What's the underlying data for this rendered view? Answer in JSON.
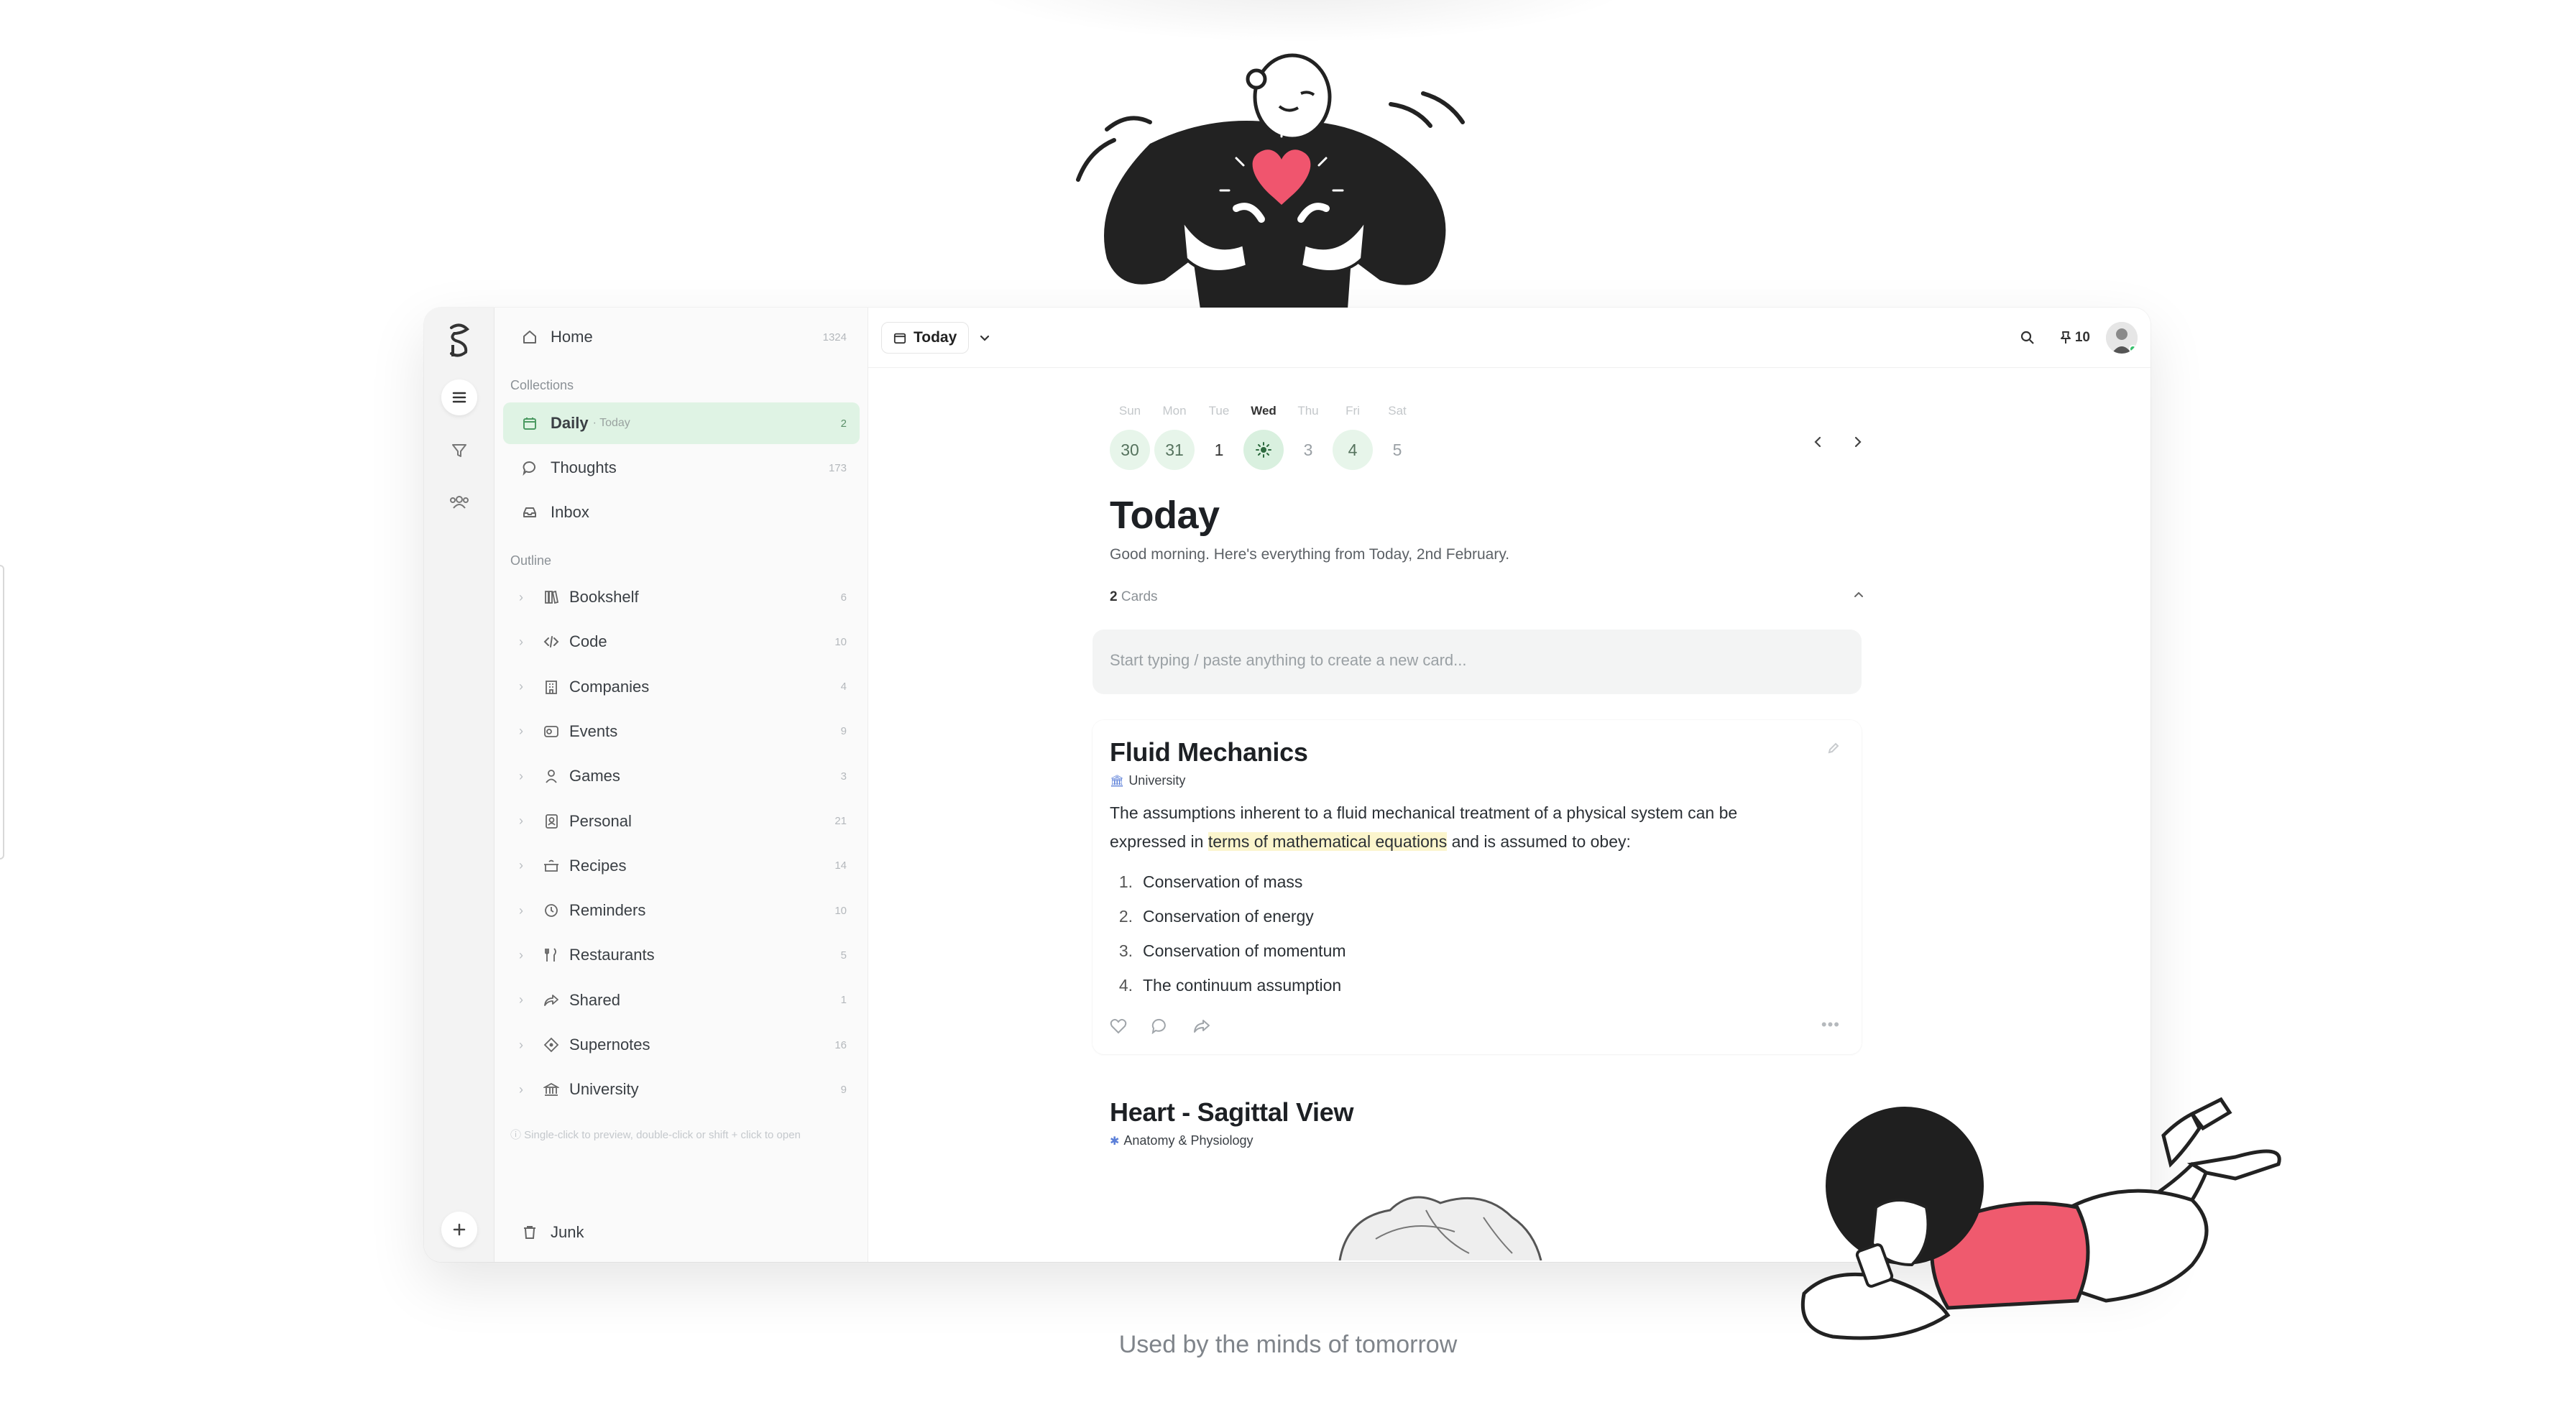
{
  "sidebar": {
    "home": {
      "label": "Home",
      "count": "1324"
    },
    "collections_label": "Collections",
    "collections": [
      {
        "label": "Daily",
        "sub": "· Today",
        "count": "2",
        "icon": "calendar-icon",
        "selected": true
      },
      {
        "label": "Thoughts",
        "count": "173",
        "icon": "speech-bubble-icon"
      },
      {
        "label": "Inbox",
        "count": "",
        "icon": "inbox-tray-icon"
      }
    ],
    "outline_label": "Outline",
    "outline": [
      {
        "label": "Bookshelf",
        "count": "6",
        "icon": "books-icon"
      },
      {
        "label": "Code",
        "count": "10",
        "icon": "code-icon"
      },
      {
        "label": "Companies",
        "count": "4",
        "icon": "building-icon"
      },
      {
        "label": "Events",
        "count": "9",
        "icon": "events-icon"
      },
      {
        "label": "Games",
        "count": "3",
        "icon": "person-icon"
      },
      {
        "label": "Personal",
        "count": "21",
        "icon": "contact-book-icon"
      },
      {
        "label": "Recipes",
        "count": "14",
        "icon": "cooking-pot-icon"
      },
      {
        "label": "Reminders",
        "count": "10",
        "icon": "clock-icon"
      },
      {
        "label": "Restaurants",
        "count": "5",
        "icon": "cutlery-icon"
      },
      {
        "label": "Shared",
        "count": "1",
        "icon": "share-icon"
      },
      {
        "label": "Supernotes",
        "count": "16",
        "icon": "diamond-icon"
      },
      {
        "label": "University",
        "count": "9",
        "icon": "university-icon"
      }
    ],
    "hint": "ⓘ Single-click to preview, double-click or shift + click to open",
    "junk": "Junk"
  },
  "topbar": {
    "today_label": "Today",
    "pin_count": "10"
  },
  "week": {
    "days": [
      "Sun",
      "Mon",
      "Tue",
      "Wed",
      "Thu",
      "Fri",
      "Sat"
    ],
    "dates": [
      "30",
      "31",
      "1",
      "",
      "3",
      "4",
      "5"
    ],
    "current_day_index": 3
  },
  "page": {
    "title": "Today",
    "subtitle": "Good morning. Here's everything from Today, 2nd February.",
    "cards_count": "2",
    "cards_label": "Cards",
    "new_card_placeholder": "Start typing / paste anything to create a new card..."
  },
  "cards": [
    {
      "title": "Fluid Mechanics",
      "tag": "University",
      "body_before": "The assumptions inherent to a fluid mechanical treatment of a physical system can be expressed in ",
      "body_highlight": "terms of mathematical equations",
      "body_after": " and is assumed to obey:",
      "list": [
        "Conservation of mass",
        "Conservation of energy",
        "Conservation of momentum",
        "The continuum assumption"
      ]
    },
    {
      "title": "Heart - Sagittal View",
      "tag": "Anatomy & Physiology"
    }
  ],
  "tagline": "Used by the minds of tomorrow",
  "colors": {
    "accent": "#dff3e4",
    "heart": "#f0556e",
    "shirt": "#ef5a6e"
  }
}
